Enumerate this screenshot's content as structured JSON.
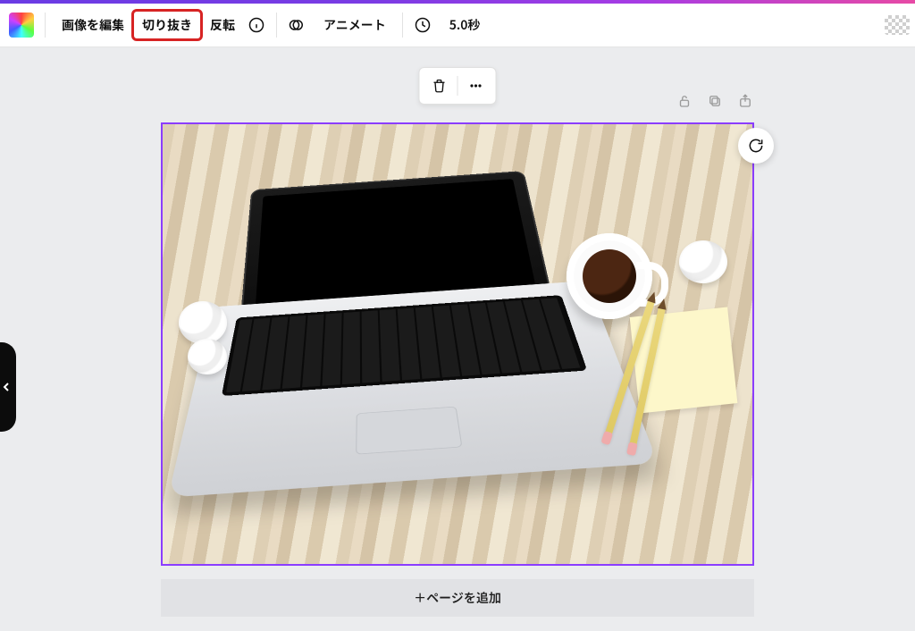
{
  "toolbar": {
    "edit_image_label": "画像を編集",
    "crop_label": "切り抜き",
    "flip_label": "反転",
    "animate_label": "アニメート",
    "duration_label": "5.0秒"
  },
  "add_page_label": "＋ページを追加",
  "colors": {
    "selection_border": "#8b3dff",
    "highlight_outline": "#d72323"
  },
  "icons": {
    "color_swatch": "color-swatch-icon",
    "info": "info-icon",
    "animate": "animate-icon",
    "clock": "clock-icon",
    "transparency": "transparency-icon",
    "trash": "trash-icon",
    "more": "more-icon",
    "lock": "lock-icon",
    "duplicate": "duplicate-icon",
    "share": "share-icon",
    "cycle": "cycle-icon",
    "expand": "expand-icon"
  }
}
